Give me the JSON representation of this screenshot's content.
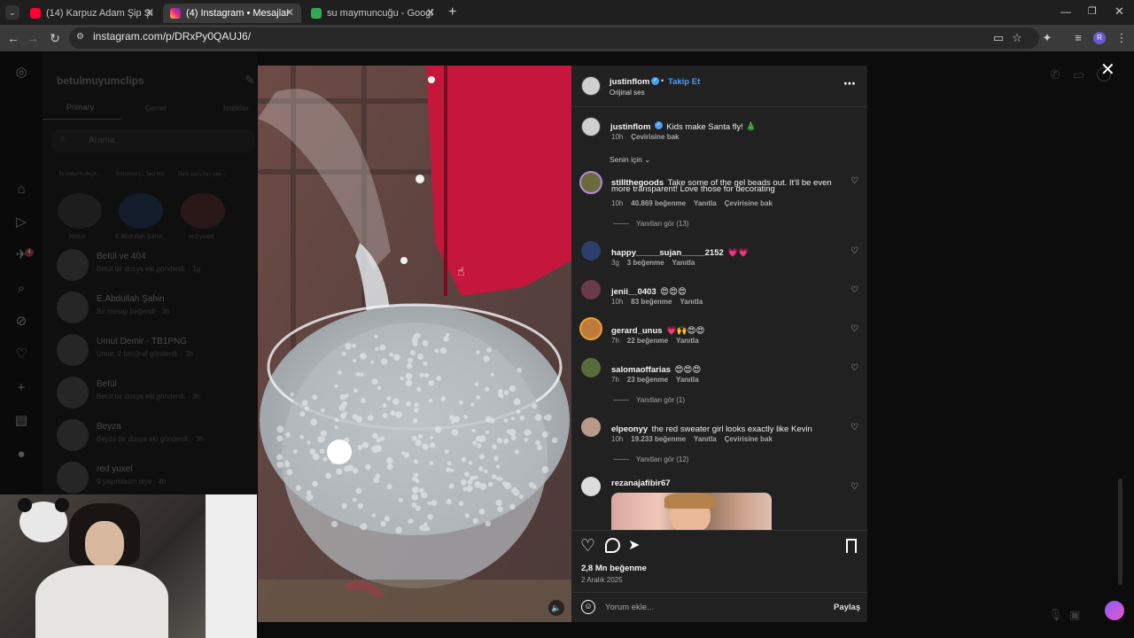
{
  "browser": {
    "tabs": [
      {
        "label": "(14) Karpuz Adam Şip Şap Şop ",
        "favicon_color": "#ff0033",
        "active": false
      },
      {
        "label": "(4) Instagram • Mesajlar",
        "favicon_color": "#d62976",
        "active": true
      },
      {
        "label": "su maymuncuğu - Google Alışv",
        "favicon_color": "#34a853",
        "active": false
      }
    ],
    "new_tab": "+",
    "url": "instagram.com/p/DRxPy0QAUJ6/",
    "profile_initial": "R"
  },
  "dm": {
    "account": "betulmuyumclips",
    "tabs": [
      "Primary",
      "Genel",
      "İstekler"
    ],
    "search_placeholder": "Arama",
    "notes": [
      {
        "note": "İlk notumu deşif...",
        "name": "Notun"
      },
      {
        "note": "Yıldızlara (... faul Mix",
        "name": "E.Abdullah Şahin"
      },
      {
        "note": "Ders çalış kas yap :)",
        "name": "red yuxel"
      }
    ],
    "conversations": [
      {
        "name": "Betül ve 404",
        "sub": "Betül bir dosya eki gönderdi. · 1g"
      },
      {
        "name": "E.Abdullah Şahin",
        "sub": "Bir mesajı beğendi · 3h"
      },
      {
        "name": "Umut Demir - TB1PNG",
        "sub": "Umut, 2 fotoğraf gönderdi. · 3h"
      },
      {
        "name": "Betül",
        "sub": "Betül bir dosya eki gönderdi. · 3h"
      },
      {
        "name": "Beyza",
        "sub": "Beyza bir dosya eki gönderdi. · 3h"
      },
      {
        "name": "red yuxel",
        "sub": "9 yaşındasın diye · 4h"
      }
    ],
    "unread_badge": "4"
  },
  "post": {
    "author": "justinflom",
    "follow": "Takip Et",
    "audio": "Orijinal ses",
    "caption": "Kids make Santa fly! 🎄",
    "caption_time": "10h",
    "caption_translate": "Çevirisine bak",
    "filter": "Senin için",
    "likes": "2,8 Mn beğenme",
    "date": "2 Aralık 2025",
    "comment_placeholder": "Yorum ekle...",
    "share": "Paylaş"
  },
  "comments": [
    {
      "user": "stillthegoods",
      "text": "Take some of the gel beads out. It'll be even",
      "text2": "more transparent! Love those for decorating",
      "time": "10h",
      "likes": "40.869 beğenme",
      "reply": "Yanıtla",
      "translate": "Çevirisine bak",
      "replies": "Yanıtları gör (13)"
    },
    {
      "user": "happy_____sujan_____2152",
      "text": "💗💗",
      "time": "3g",
      "likes": "3 beğenme",
      "reply": "Yanıtla"
    },
    {
      "user": "jenii__0403",
      "text": "😍😍😍",
      "time": "10h",
      "likes": "83 beğenme",
      "reply": "Yanıtla"
    },
    {
      "user": "gerard_unus",
      "text": "💗🙌😍😍",
      "time": "7h",
      "likes": "22 beğenme",
      "reply": "Yanıtla"
    },
    {
      "user": "salomaoffarias",
      "text": "😍😍😍",
      "time": "7h",
      "likes": "23 beğenme",
      "reply": "Yanıtla",
      "replies": "Yanıtları gör (1)"
    },
    {
      "user": "elpeonyy",
      "text": "the red sweater girl looks exactly like Kevin",
      "time": "10h",
      "likes": "19.233 beğenme",
      "reply": "Yanıtla",
      "translate": "Çevirisine bak",
      "replies": "Yanıtları gör (12)"
    },
    {
      "user": "rezanajafibir67"
    }
  ],
  "colors": {
    "accent_blue": "#4a9ef6",
    "panel_bg": "#212121",
    "red_sweater": "#c4173b"
  }
}
